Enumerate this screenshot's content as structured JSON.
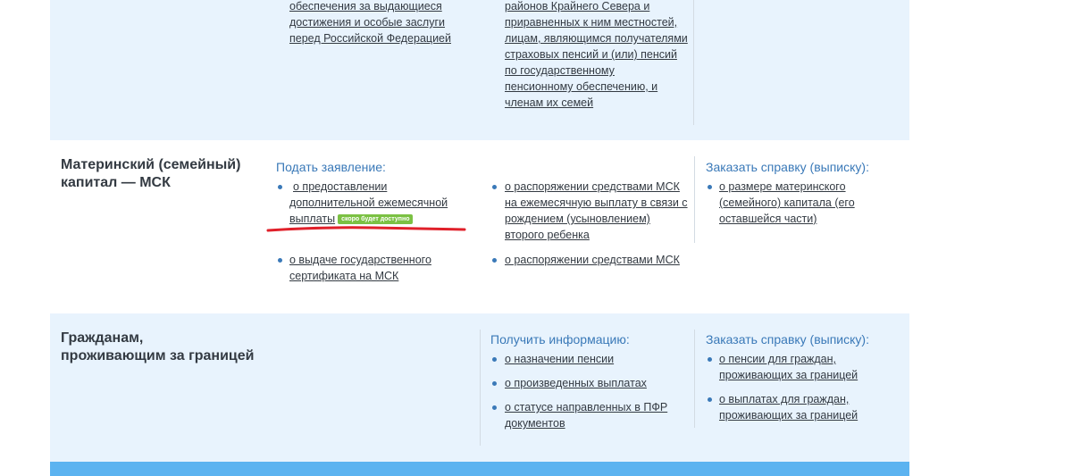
{
  "top_row": {
    "col1_lines": [
      "обеспечения за выдающиеся",
      "достижения и особые заслуги",
      "перед Российской Федерацией"
    ],
    "col2_lines": [
      "районов Крайнего Севера и",
      "приравненных к ним местностей,",
      "лицам, являющимся получателями",
      "страховых пенсий и (или) пенсий",
      "по государственному",
      "пенсионному обеспечению, и",
      "членам их семей"
    ]
  },
  "msk": {
    "title_line1": "Материнский (семейный)",
    "title_line2": "капитал — МСК",
    "apply_heading": "Подать заявление:",
    "item1_lines": [
      "о предоставлении",
      "дополнительной ежемесячной",
      "выплаты"
    ],
    "item1_badge": "скоро будет доступно",
    "item2_lines": [
      "о выдаче государственного",
      "сертификата на МСК"
    ],
    "item3_lines": [
      "о распоряжении средствами МСК",
      "на ежемесячную выплату в связи с",
      "рождением (усыновлением)",
      "второго ребенка"
    ],
    "item4_lines": [
      "о распоряжении средствами МСК"
    ],
    "order_heading": "Заказать справку (выписку):",
    "item5_lines": [
      "о размере материнского",
      "(семейного) капитала (его",
      "оставшейся части)"
    ]
  },
  "abroad": {
    "title_line1": "Гражданам,",
    "title_line2": "проживающим за границей",
    "info_heading": "Получить информацию:",
    "info_items": [
      [
        "о назначении пенсии"
      ],
      [
        "о произведенных выплатах"
      ],
      [
        "о статусе направленных в ПФР",
        "документов"
      ]
    ],
    "order_heading": "Заказать справку (выписку):",
    "order_items": [
      [
        "о пенсии для граждан,",
        "проживающих за границей"
      ],
      [
        "о выплатах для граждан,",
        "проживающих за границей"
      ]
    ]
  },
  "colors": {
    "heading": "#3a79b8",
    "text": "#333a42",
    "row_bg": "#e8f3fd",
    "badge": "#7bc143",
    "annotation": "#e0202a",
    "bottom_bar": "#5cb3f0"
  }
}
